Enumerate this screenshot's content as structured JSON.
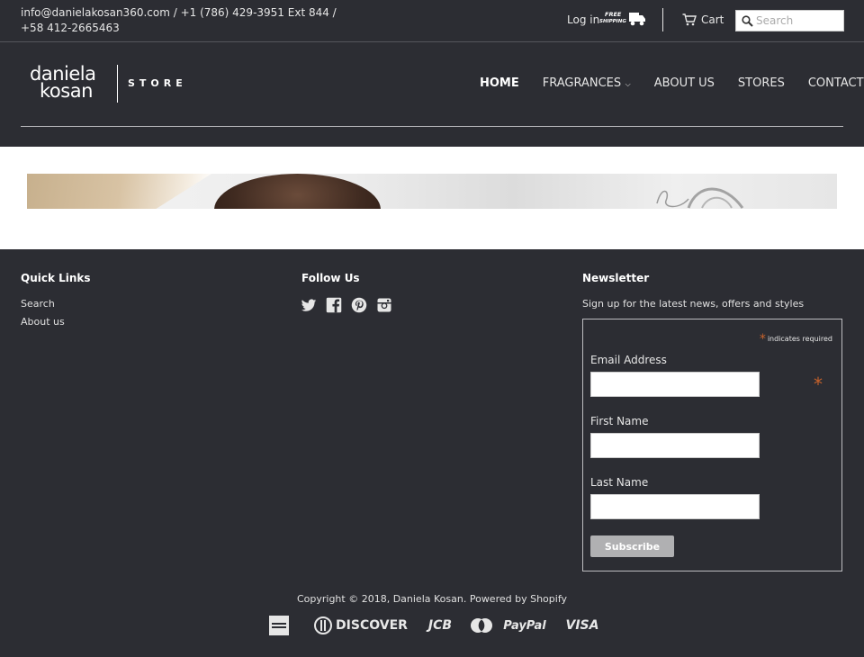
{
  "topbar": {
    "contact": "info@danielakosan360.com / +1 (786) 429-3951 Ext 844 / +58 412-2665463",
    "login": "Log in",
    "free_shipping_line1": "FREE",
    "free_shipping_line2": "SHIPPING",
    "cart": "Cart",
    "search_placeholder": "Search"
  },
  "logo": {
    "line1": "daniela",
    "line2": "kosan",
    "suffix": "STORE"
  },
  "nav": {
    "items": [
      {
        "label": "HOME"
      },
      {
        "label": "FRAGRANCES"
      },
      {
        "label": "ABOUT US"
      },
      {
        "label": "STORES"
      },
      {
        "label": "CONTACT"
      }
    ]
  },
  "footer": {
    "quick_links_title": "Quick Links",
    "quick_links": [
      "Search",
      "About us"
    ],
    "follow_title": "Follow Us",
    "newsletter_title": "Newsletter",
    "newsletter_desc": "Sign up for the latest news, offers and styles",
    "required_note": "indicates required",
    "email_label": "Email Address",
    "first_name_label": "First Name",
    "last_name_label": "Last Name",
    "subscribe": "Subscribe",
    "copyright_prefix": "Copyright © 2018, Daniela Kosan.",
    "copyright_suffix": "Powered by Shopify",
    "payments": [
      "DISCOVER",
      "JCB",
      "PayPal",
      "VISA"
    ]
  },
  "colors": {
    "background": "#2c2d33",
    "accent_star": "#c7622b",
    "button": "#b0b0b2"
  }
}
